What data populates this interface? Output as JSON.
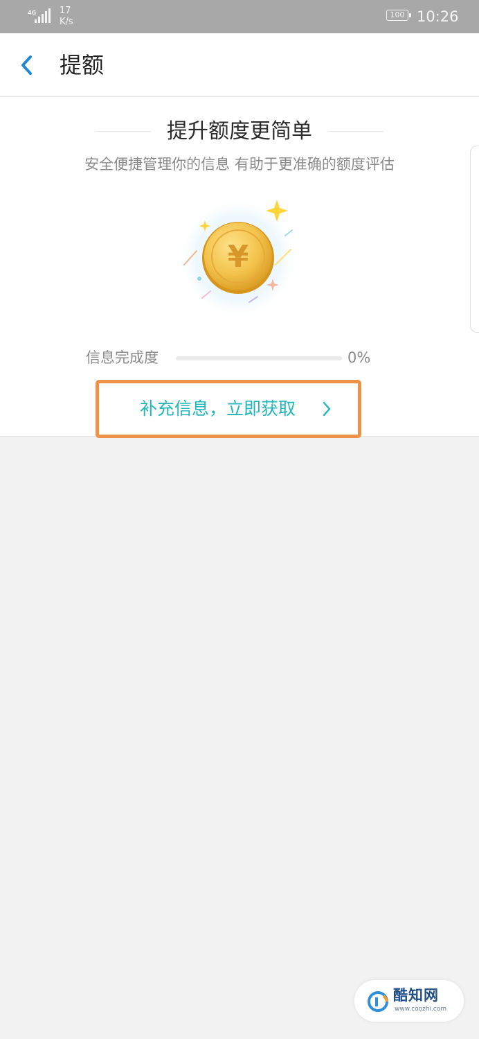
{
  "status_bar": {
    "network": "4G",
    "speed_value": "17",
    "speed_unit": "K/s",
    "battery": "100",
    "time": "10:26"
  },
  "header": {
    "back_icon": "chevron-left-icon",
    "title": "提额"
  },
  "hero": {
    "title": "提升额度更简单",
    "subtitle": "安全便捷管理你的信息 有助于更准确的额度评估",
    "illustration": "gold-coin-yuan-icon"
  },
  "progress": {
    "label": "信息完成度",
    "value_text": "0%",
    "value": 0
  },
  "cta": {
    "label": "补充信息，立即获取",
    "icon": "chevron-right-icon"
  },
  "watermark": {
    "name": "酷知网",
    "url": "www.coozhi.com"
  },
  "colors": {
    "accent": "#21b7b9",
    "back_icon": "#1e88d6",
    "highlight_box": "#f0914a",
    "status_bar": "#a8a8a8",
    "page_background": "#f2f2f2"
  }
}
